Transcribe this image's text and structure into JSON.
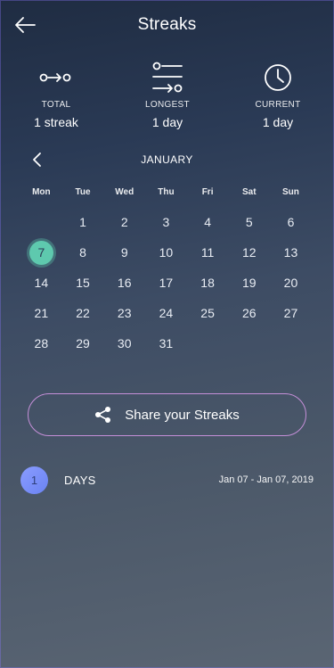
{
  "header": {
    "title": "Streaks",
    "back_icon": "arrow-left-icon"
  },
  "stats": [
    {
      "icon": "streak-chain-icon",
      "label": "TOTAL",
      "value": "1 streak"
    },
    {
      "icon": "list-sliders-icon",
      "label": "LONGEST",
      "value": "1 day"
    },
    {
      "icon": "clock-icon",
      "label": "CURRENT",
      "value": "1 day"
    }
  ],
  "calendar": {
    "month": "JANUARY",
    "weekdays": [
      "Mon",
      "Tue",
      "Wed",
      "Thu",
      "Fri",
      "Sat",
      "Sun"
    ],
    "leading_blanks": 1,
    "days": [
      "1",
      "2",
      "3",
      "4",
      "5",
      "6",
      "7",
      "8",
      "9",
      "10",
      "11",
      "12",
      "13",
      "14",
      "15",
      "16",
      "17",
      "18",
      "19",
      "20",
      "21",
      "22",
      "23",
      "24",
      "25",
      "26",
      "27",
      "28",
      "29",
      "30",
      "31"
    ],
    "selected_day": "7",
    "selected_color": "#5ec9ae"
  },
  "share": {
    "label": "Share your Streaks",
    "icon": "share-icon",
    "border_color": "#c58fd8"
  },
  "streak": {
    "count": "1",
    "label": "DAYS",
    "range": "Jan 07 - Jan 07, 2019",
    "badge_color": "#7a90fb"
  }
}
